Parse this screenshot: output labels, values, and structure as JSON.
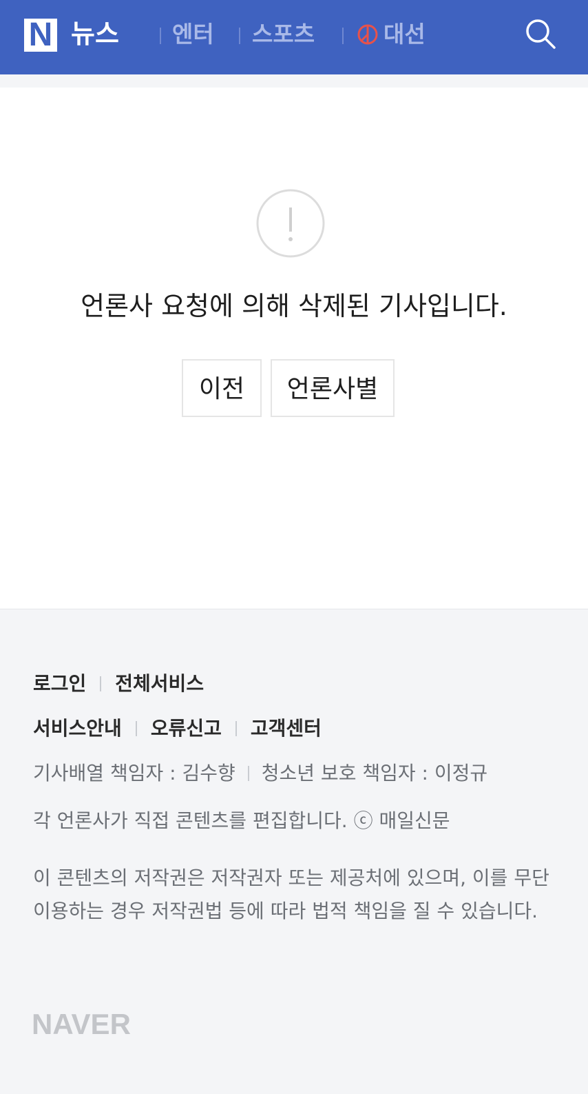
{
  "header": {
    "logo_letter": "N",
    "logo_text": "뉴스",
    "nav": [
      {
        "label": "엔터"
      },
      {
        "label": "스포츠"
      },
      {
        "label": "대선"
      }
    ],
    "bg_color": "#3f62c0",
    "election_icon_color": "#e8524a"
  },
  "main": {
    "message": "언론사 요청에 의해 삭제된 기사입니다.",
    "buttons": {
      "prev": "이전",
      "by_press": "언론사별"
    }
  },
  "footer": {
    "row1": [
      "로그인",
      "전체서비스"
    ],
    "row2": [
      "서비스안내",
      "오류신고",
      "고객센터"
    ],
    "responsible": {
      "editor": "기사배열 책임자 : 김수향",
      "youth": "청소년 보호 책임자 : 이정규"
    },
    "edit_note": "각 언론사가 직접 콘텐츠를 편집합니다. ⓒ 매일신문",
    "copyright": "이 콘텐츠의 저작권은 저작권자 또는 제공처에 있으며, 이를 무단 이용하는 경우 저작권법 등에 따라 법적 책임을 질 수 있습니다.",
    "brand": "NAVER"
  }
}
